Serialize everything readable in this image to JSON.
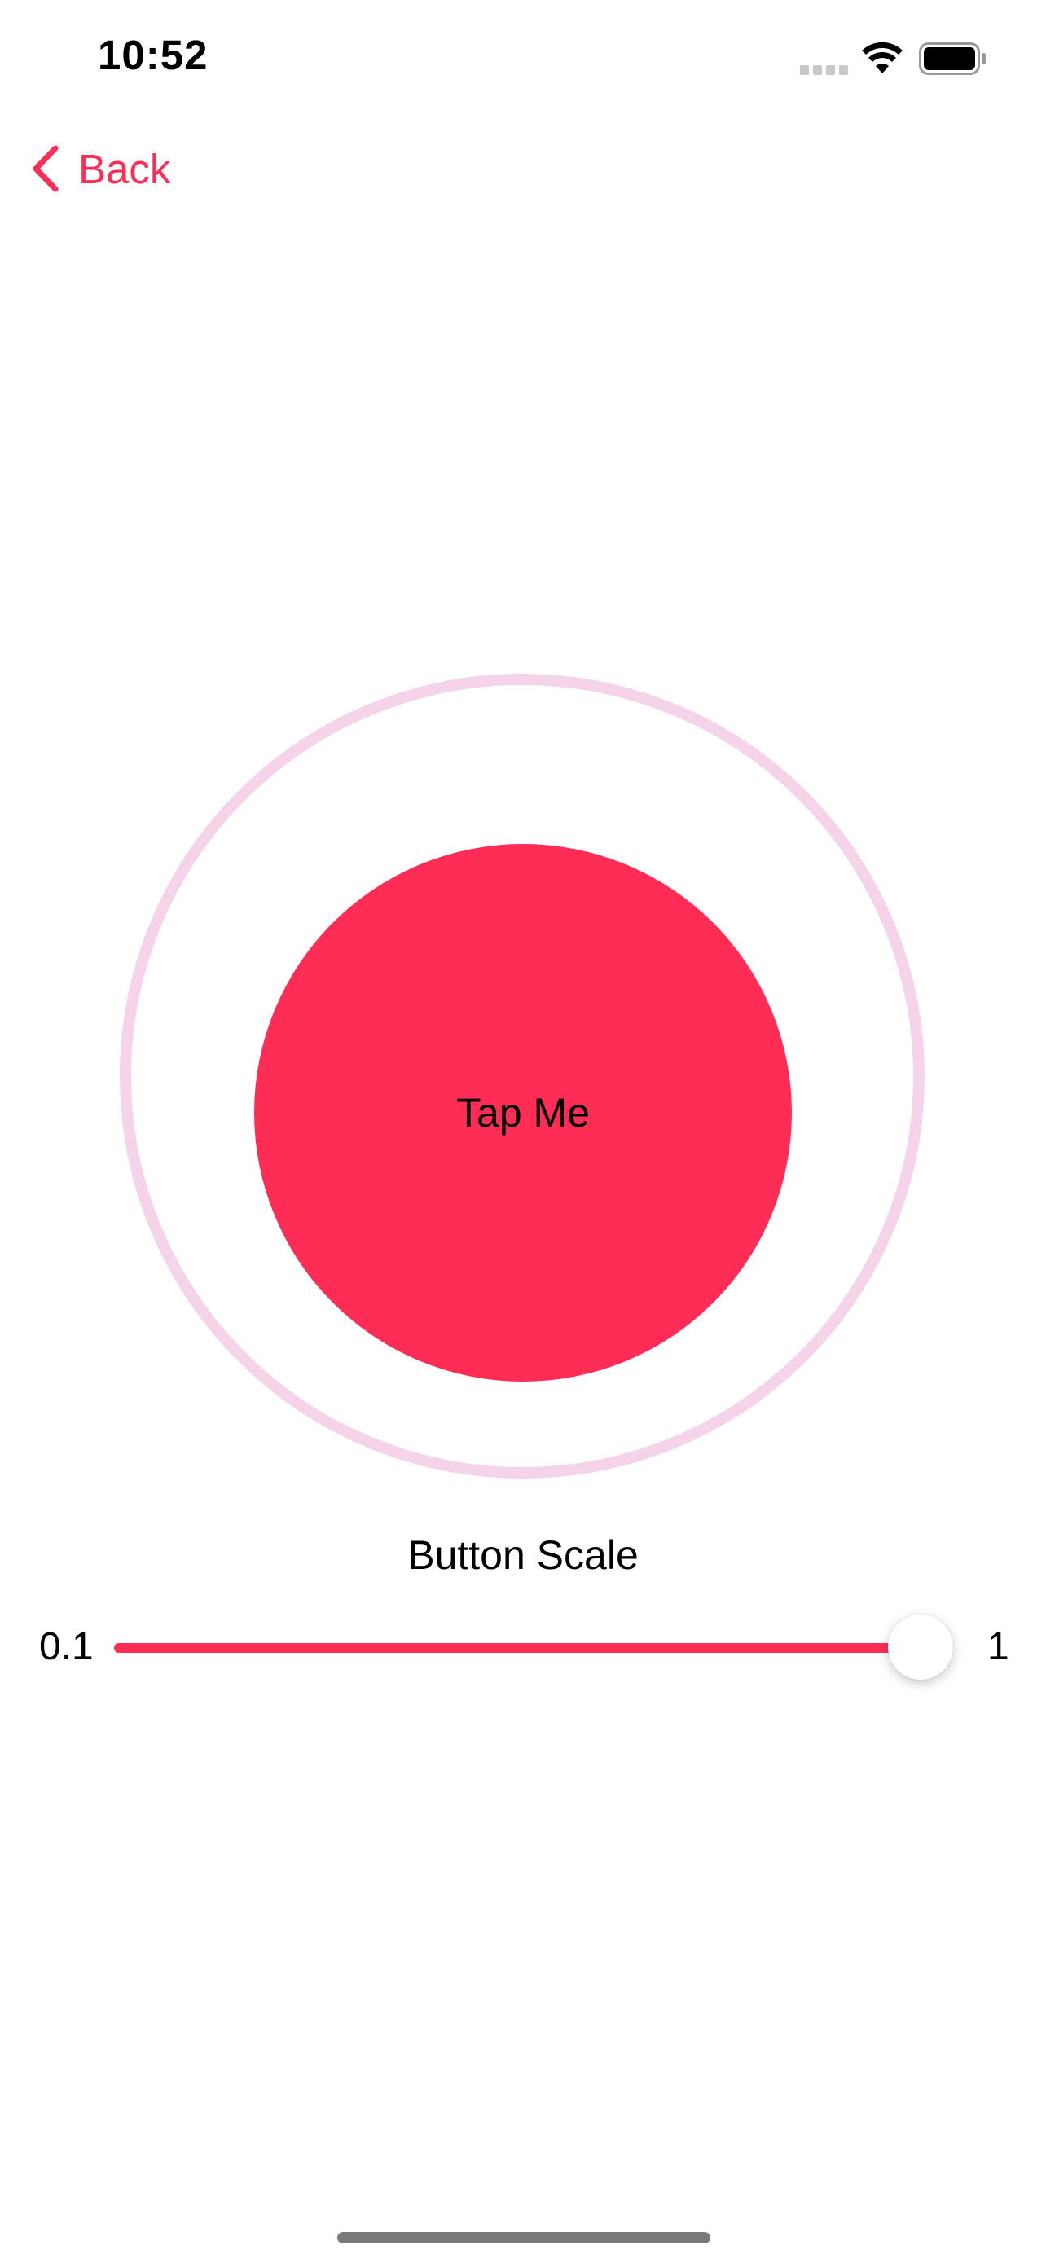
{
  "status_bar": {
    "time": "10:52",
    "icons": [
      "signal-icon",
      "wifi-icon",
      "battery-icon"
    ]
  },
  "nav": {
    "back_label": "Back",
    "back_icon": "chevron-left-icon"
  },
  "main": {
    "button_label": "Tap Me"
  },
  "slider": {
    "title": "Button Scale",
    "min_label": "0.1",
    "max_label": "1",
    "min": 0.1,
    "max": 1,
    "value": 1
  },
  "colors": {
    "accent": "#ff2d55",
    "ring": "#f5d3e8",
    "background": "#ffffff",
    "text": "#000000"
  }
}
